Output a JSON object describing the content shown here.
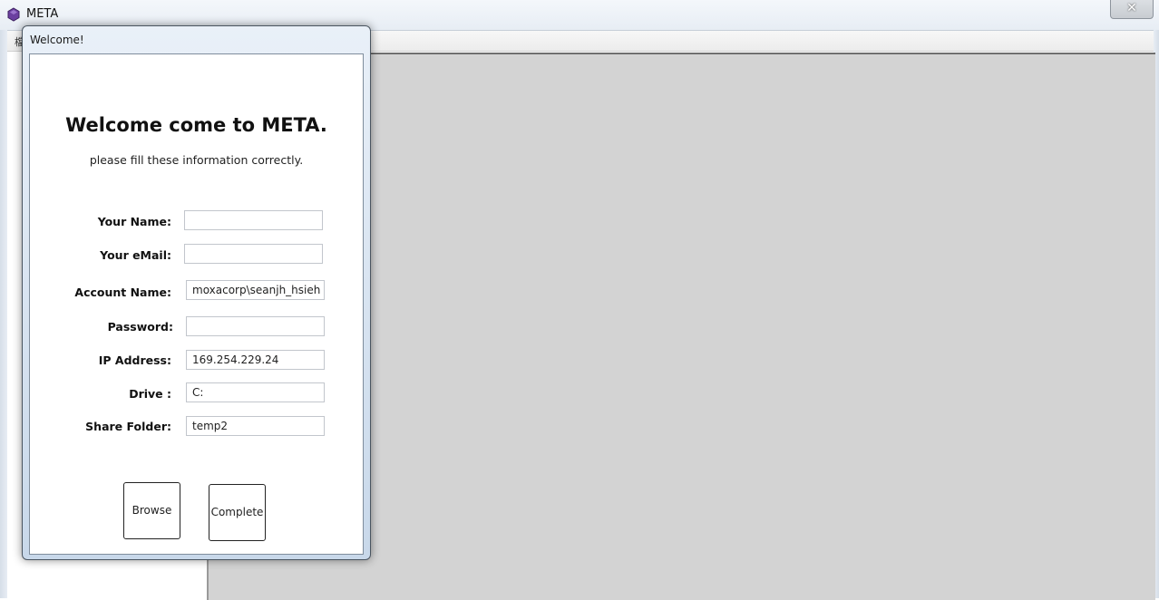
{
  "window": {
    "title": "META",
    "close_glyph": "✕",
    "menubar_glyph": "檔"
  },
  "dialog": {
    "title": "Welcome!",
    "heading": "Welcome come to META.",
    "subheading": "please fill these information correctly.",
    "fields": {
      "name": {
        "label": "Your Name:",
        "value": ""
      },
      "email": {
        "label": "Your eMail:",
        "value": ""
      },
      "account": {
        "label": "Account Name:",
        "value": "moxacorp\\seanjh_hsieh"
      },
      "password": {
        "label": "Password:",
        "value": ""
      },
      "ip": {
        "label": "IP Address:",
        "value": "169.254.229.24"
      },
      "drive": {
        "label": "Drive :",
        "value": "C:"
      },
      "share": {
        "label": "Share Folder:",
        "value": "temp2"
      }
    },
    "buttons": {
      "browse": "Browse",
      "complete": "Complete"
    }
  },
  "colors": {
    "app_icon": "#6b3fa0",
    "content_background": "#d3d3d3"
  }
}
